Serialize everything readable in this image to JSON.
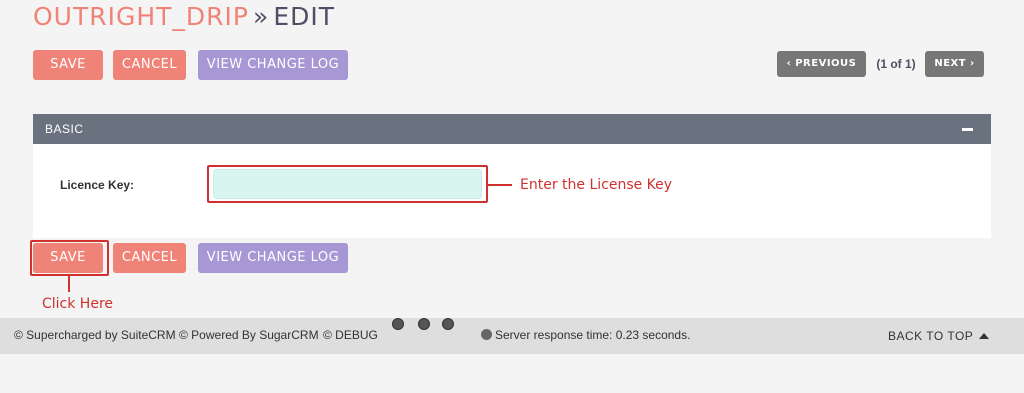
{
  "header": {
    "module": "OUTRIGHT_DRIP",
    "separator": "»",
    "action": "EDIT"
  },
  "actions": {
    "save": "SAVE",
    "cancel": "CANCEL",
    "view_change_log": "VIEW CHANGE LOG"
  },
  "pager": {
    "previous": "PREVIOUS",
    "count": "(1 of 1)",
    "next": "NEXT"
  },
  "panel": {
    "title": "BASIC",
    "fields": [
      {
        "label": "Licence Key:",
        "value": ""
      }
    ]
  },
  "annotations": {
    "license_hint": "Enter the License Key",
    "click_hint": "Click Here",
    "color": "#d0312d"
  },
  "footer": {
    "supercharged": "© Supercharged by SuiteCRM",
    "powered": "© Powered By SugarCRM",
    "debug": "© DEBUG",
    "response": "Server response time: 0.23 seconds.",
    "back_to_top": "BACK TO TOP"
  },
  "colors": {
    "accent": "#f08377",
    "secondary": "#a797d4",
    "panel_header": "#6a7280",
    "input_bg": "#d8f5ef"
  }
}
